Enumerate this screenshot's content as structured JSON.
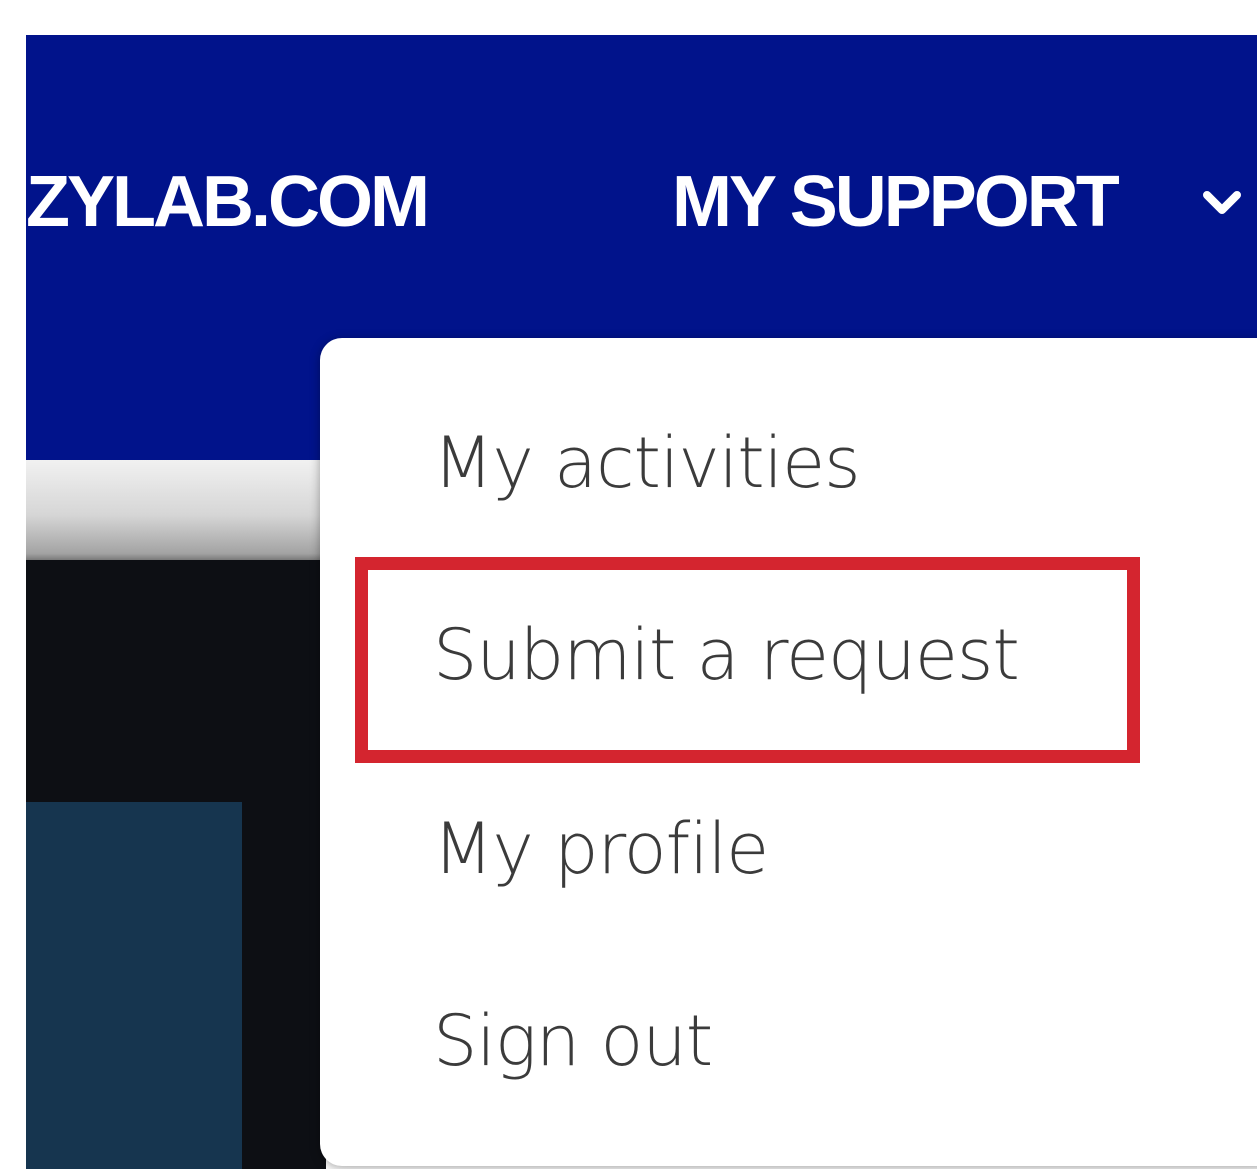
{
  "header": {
    "background_color": "#01138b",
    "site_link_label": "ZYLAB.COM",
    "support_menu_label": "MY SUPPORT",
    "support_menu_icon": "chevron-down-icon"
  },
  "dropdown": {
    "items": [
      {
        "label": "My activities"
      },
      {
        "label": "Submit a request",
        "highlighted": true
      },
      {
        "label": "My profile"
      },
      {
        "label": "Sign out"
      }
    ],
    "highlight_color": "#d4252f"
  }
}
